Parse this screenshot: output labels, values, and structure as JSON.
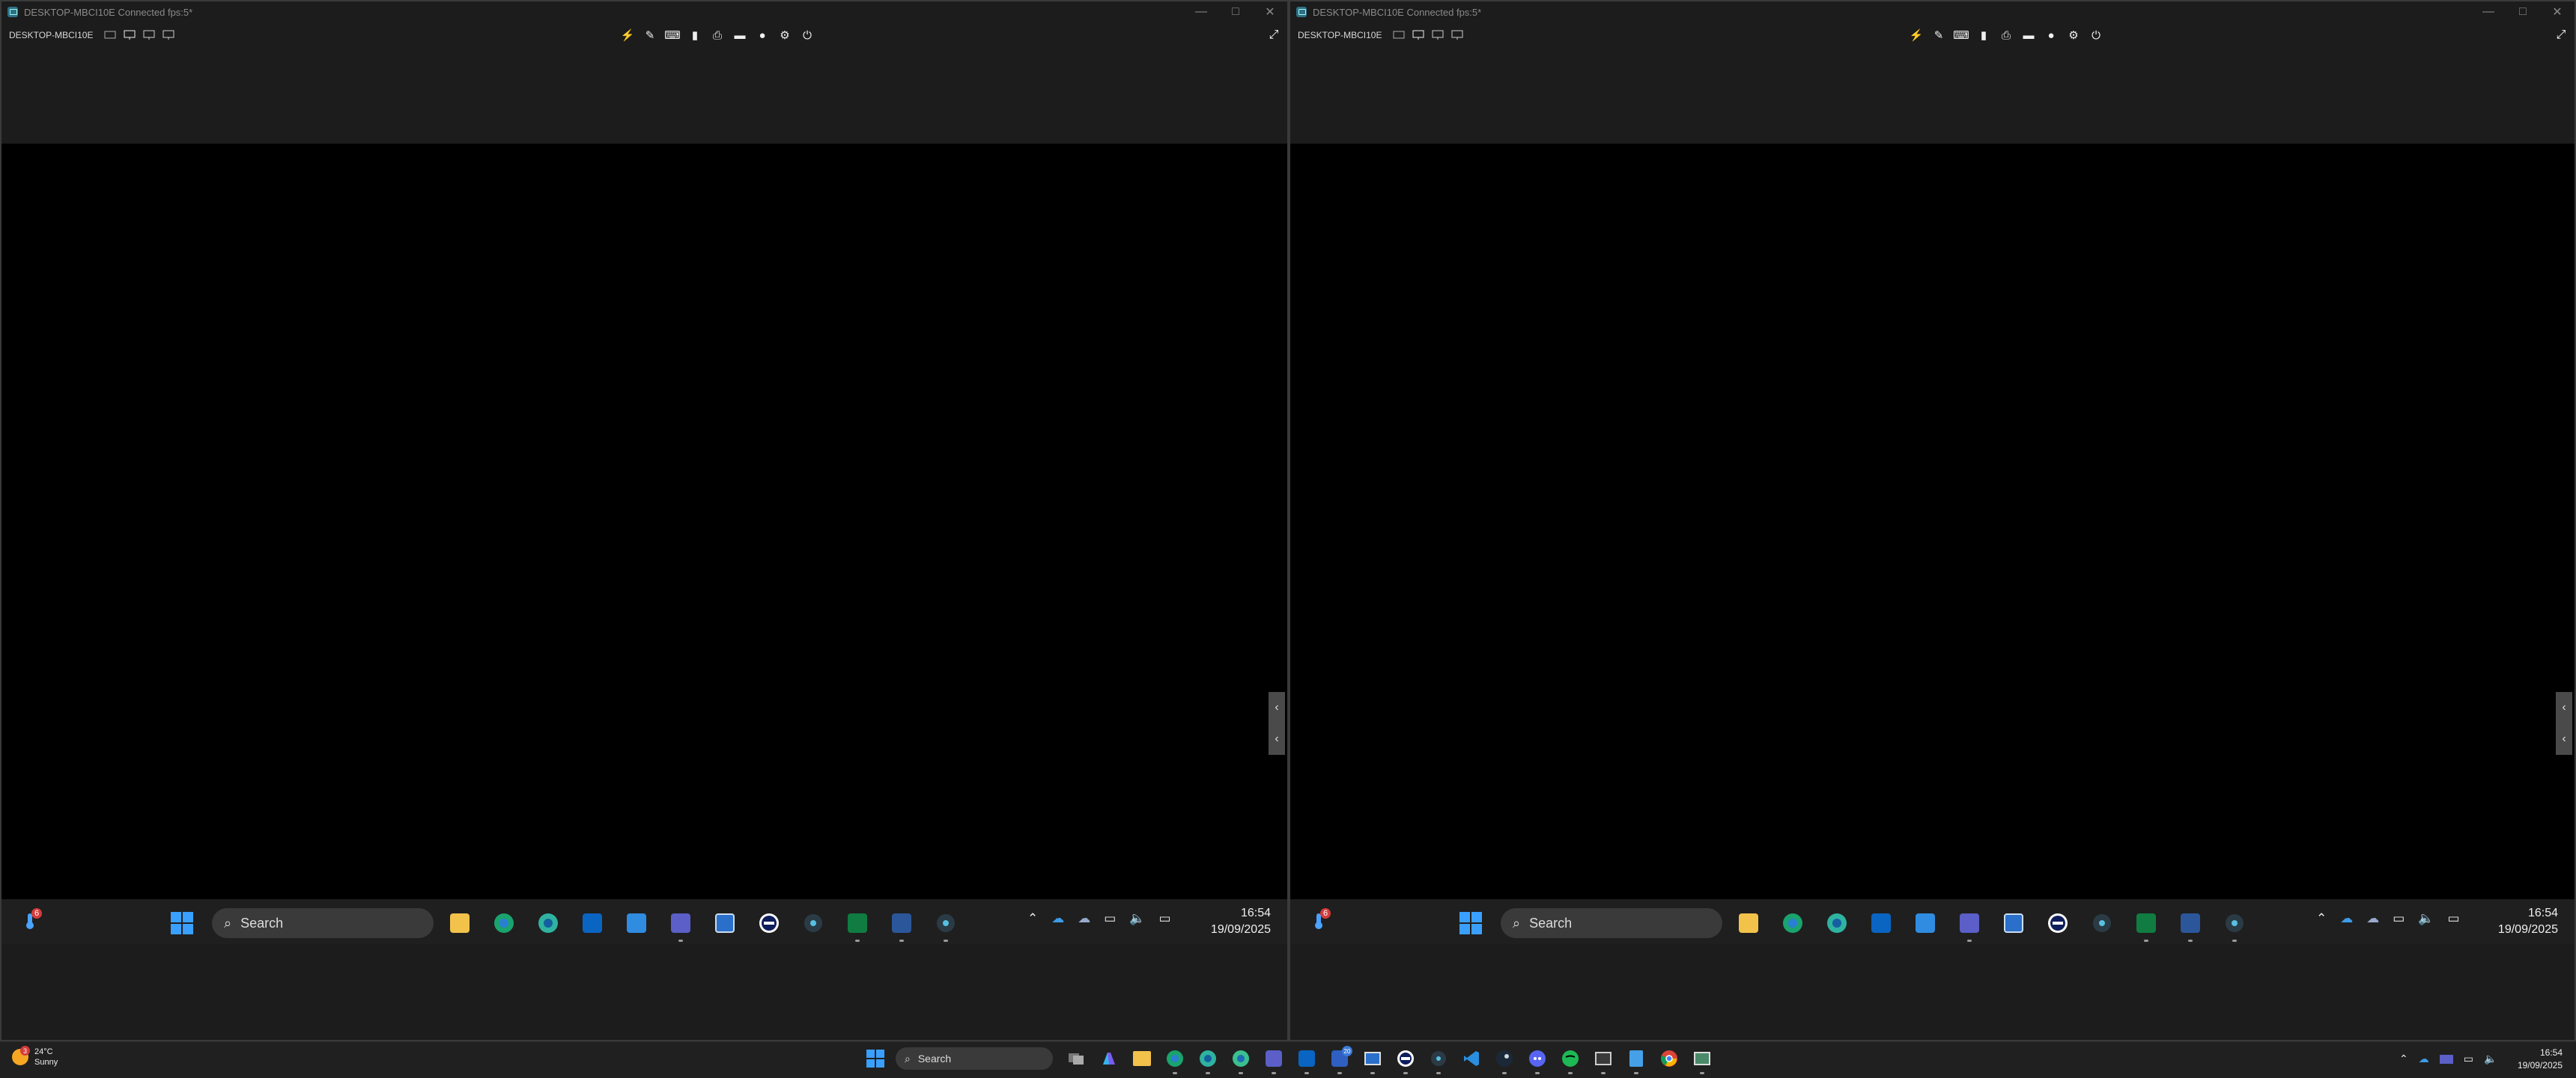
{
  "remote_windows": [
    {
      "title": "DESKTOP-MBCI10E Connected fps:5*",
      "host": "DESKTOP-MBCI10E",
      "taskbar": {
        "weather_badge": "6",
        "search_placeholder": "Search",
        "teams_badge": "",
        "time": "16:54",
        "date": "19/09/2025"
      }
    },
    {
      "title": "DESKTOP-MBCI10E Connected fps:5*",
      "host": "DESKTOP-MBCI10E",
      "taskbar": {
        "weather_badge": "6",
        "search_placeholder": "Search",
        "teams_badge": "",
        "time": "16:54",
        "date": "19/09/2025"
      }
    }
  ],
  "toolbar_icons": [
    "lightning-icon",
    "edit-icon",
    "keyboard-icon",
    "clipboard-icon",
    "print-icon",
    "folder-icon",
    "chat-icon",
    "gear-icon",
    "power-icon"
  ],
  "main_taskbar": {
    "weather_temp": "24°C",
    "weather_desc": "Sunny",
    "weather_badge": "3",
    "search_placeholder": "Search",
    "time": "16:54",
    "date": "19/09/2025",
    "teams_badge": "20"
  },
  "colors": {
    "accent_blue": "#0078d4",
    "excel_green": "#107c41",
    "word_blue": "#2b579a",
    "screen_black": "#000000"
  }
}
